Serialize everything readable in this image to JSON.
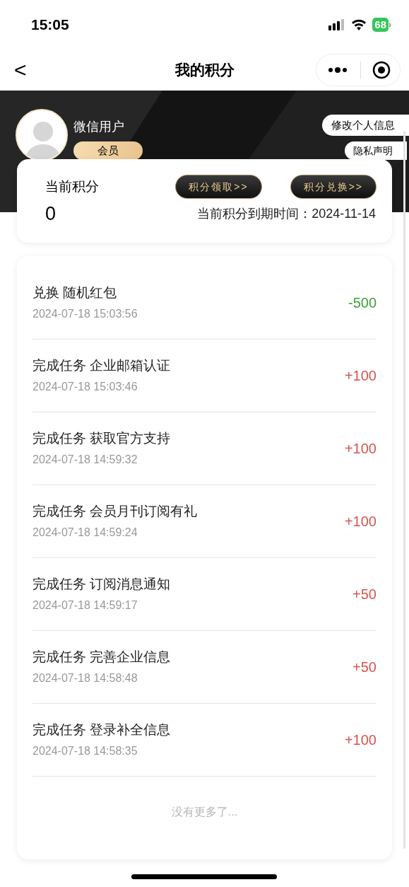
{
  "status_bar": {
    "time": "15:05",
    "battery": "68"
  },
  "nav": {
    "back": "<",
    "title": "我的积分"
  },
  "profile": {
    "name": "微信用户",
    "badge": "会员",
    "edit_button": "修改个人信息",
    "privacy_button": "隐私声明"
  },
  "points": {
    "label": "当前积分",
    "value": "0",
    "buttons": [
      "积分领取>>",
      "积分兑换>>"
    ],
    "expiry_label": "当前积分到期时间：",
    "expiry_date": "2024-11-14"
  },
  "records": [
    {
      "title": "兑换 随机红包",
      "time": "2024-07-18 15:03:56",
      "amount": "-500",
      "kind": "spend"
    },
    {
      "title": "完成任务 企业邮箱认证",
      "time": "2024-07-18 15:03:46",
      "amount": "+100",
      "kind": "earn"
    },
    {
      "title": "完成任务 获取官方支持",
      "time": "2024-07-18 14:59:32",
      "amount": "+100",
      "kind": "earn"
    },
    {
      "title": "完成任务 会员月刊订阅有礼",
      "time": "2024-07-18 14:59:24",
      "amount": "+100",
      "kind": "earn"
    },
    {
      "title": "完成任务 订阅消息通知",
      "time": "2024-07-18 14:59:17",
      "amount": "+50",
      "kind": "earn"
    },
    {
      "title": "完成任务 完善企业信息",
      "time": "2024-07-18 14:58:48",
      "amount": "+50",
      "kind": "earn"
    },
    {
      "title": "完成任务 登录补全信息",
      "time": "2024-07-18 14:58:35",
      "amount": "+100",
      "kind": "earn"
    }
  ],
  "end_note": "没有更多了..."
}
